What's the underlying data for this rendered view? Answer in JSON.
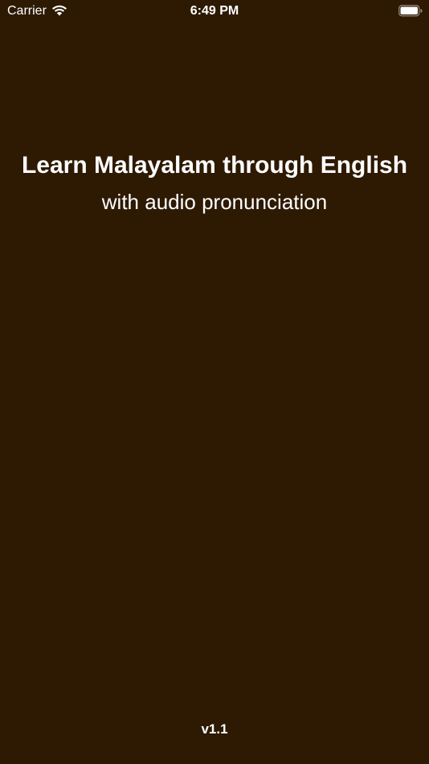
{
  "status_bar": {
    "carrier": "Carrier",
    "time": "6:49 PM",
    "icons": [
      "wifi-icon",
      "battery-icon"
    ]
  },
  "splash": {
    "title": "Learn Malayalam through English",
    "subtitle": "with audio pronunciation",
    "version": "v1.1"
  },
  "colors": {
    "background": "#2e1a03",
    "text": "#ffffff"
  }
}
